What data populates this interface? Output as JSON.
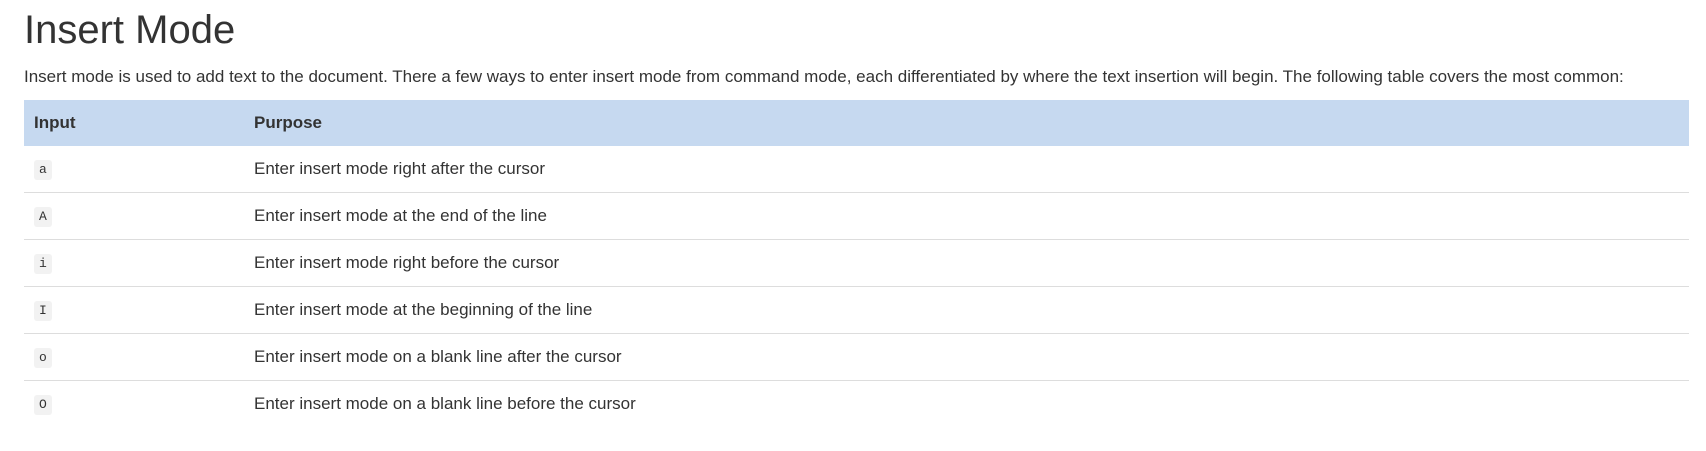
{
  "section": {
    "title": "Insert Mode",
    "intro": "Insert mode is used to add text to the document. There a few ways to enter insert mode from command mode, each differentiated by where the text insertion will begin. The following table covers the most common:"
  },
  "table": {
    "headers": [
      "Input",
      "Purpose"
    ],
    "rows": [
      {
        "input": "a",
        "purpose": "Enter insert mode right after the cursor"
      },
      {
        "input": "A",
        "purpose": "Enter insert mode at the end of the line"
      },
      {
        "input": "i",
        "purpose": "Enter insert mode right before the cursor"
      },
      {
        "input": "I",
        "purpose": "Enter insert mode at the beginning of the line"
      },
      {
        "input": "o",
        "purpose": "Enter insert mode on a blank line after the cursor"
      },
      {
        "input": "O",
        "purpose": "Enter insert mode on a blank line before the cursor"
      }
    ]
  },
  "colors": {
    "header_background": "#c6d9f0",
    "row_divider": "#dddddd",
    "code_background": "#f2f2f2",
    "text": "#333333"
  }
}
